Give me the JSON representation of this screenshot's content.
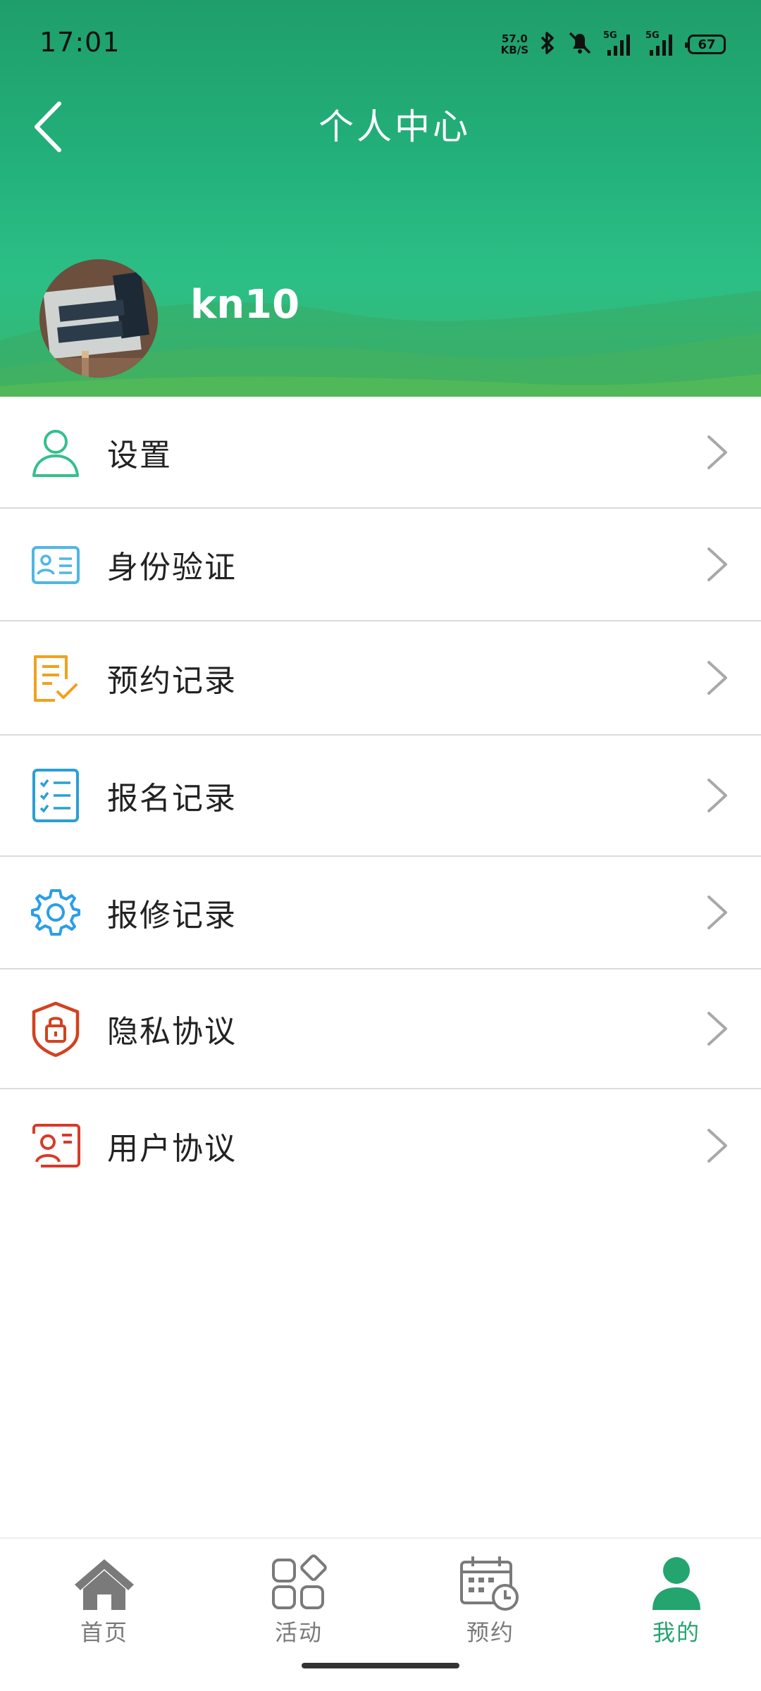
{
  "status_bar": {
    "time": "17:01",
    "net_speed_value": "57.0",
    "net_speed_unit": "KB/S",
    "bluetooth_icon": "bluetooth-icon",
    "silent_icon": "bell-off-icon",
    "signal1_label": "5G",
    "signal2_label": "5G",
    "battery": "67"
  },
  "header": {
    "title": "个人中心",
    "back_icon": "chevron-left-icon",
    "username": "kn10",
    "gradient_top": "#1f9e6a",
    "gradient_bottom": "#38b56e"
  },
  "menu": {
    "items": [
      {
        "label": "设置",
        "icon": "user-outline-icon",
        "color": "#35bf8c"
      },
      {
        "label": "身份验证",
        "icon": "id-card-icon",
        "color": "#4fb6e6"
      },
      {
        "label": "预约记录",
        "icon": "document-check-icon",
        "color": "#f0a21c"
      },
      {
        "label": "报名记录",
        "icon": "checklist-icon",
        "color": "#2a9fd6"
      },
      {
        "label": "报修记录",
        "icon": "gear-icon",
        "color": "#2a9ee8"
      },
      {
        "label": "隐私协议",
        "icon": "shield-lock-icon",
        "color": "#d2421f"
      },
      {
        "label": "用户协议",
        "icon": "user-card-icon",
        "color": "#d83a2a"
      }
    ]
  },
  "tabbar": {
    "tabs": [
      {
        "label": "首页",
        "icon": "home-icon"
      },
      {
        "label": "活动",
        "icon": "apps-icon"
      },
      {
        "label": "预约",
        "icon": "calendar-clock-icon"
      },
      {
        "label": "我的",
        "icon": "person-icon"
      }
    ],
    "active_index": 3,
    "active_color": "#24a46e",
    "inactive_color": "#7a7a7a"
  }
}
